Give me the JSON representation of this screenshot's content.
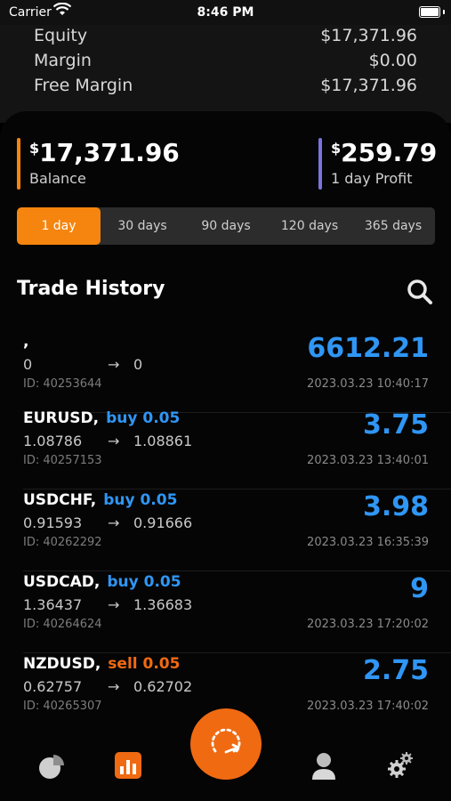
{
  "status_bar": {
    "carrier": "Carrier",
    "time": "8:46 PM"
  },
  "account": [
    {
      "label": "Equity",
      "value": "$17,371.96"
    },
    {
      "label": "Margin",
      "value": "$0.00"
    },
    {
      "label": "Free Margin",
      "value": "$17,371.96"
    }
  ],
  "balance": {
    "currency": "$",
    "amount": "17,371.96",
    "label": "Balance",
    "bar_color": "#f5850f"
  },
  "profit": {
    "currency": "$",
    "amount": "259.79",
    "label": "1 day Profit",
    "bar_color": "#7b74e0"
  },
  "periods": {
    "selected": "1 day",
    "options": [
      "1 day",
      "30 days",
      "90 days",
      "120 days",
      "365 days"
    ]
  },
  "history": {
    "title": "Trade History"
  },
  "trades": [
    {
      "symbol": ",",
      "side": "",
      "side_color": "",
      "open": "0",
      "arrow": "→",
      "close": "0",
      "id": "ID: 40253644",
      "profit": "6612.21",
      "date": "2023.03.23 10:40:17"
    },
    {
      "symbol": "EURUSD,",
      "side": "buy 0.05",
      "side_color": "#2f96f5",
      "open": "1.08786",
      "arrow": "→",
      "close": "1.08861",
      "id": "ID: 40257153",
      "profit": "3.75",
      "date": "2023.03.23 13:40:01"
    },
    {
      "symbol": "USDCHF,",
      "side": "buy 0.05",
      "side_color": "#2f96f5",
      "open": "0.91593",
      "arrow": "→",
      "close": "0.91666",
      "id": "ID: 40262292",
      "profit": "3.98",
      "date": "2023.03.23 16:35:39"
    },
    {
      "symbol": "USDCAD,",
      "side": "buy 0.05",
      "side_color": "#2f96f5",
      "open": "1.36437",
      "arrow": "→",
      "close": "1.36683",
      "id": "ID: 40264624",
      "profit": "9",
      "date": "2023.03.23 17:20:02"
    },
    {
      "symbol": "NZDUSD,",
      "side": "sell 0.05",
      "side_color": "#f06a12",
      "open": "0.62757",
      "arrow": "→",
      "close": "0.62702",
      "id": "ID: 40265307",
      "profit": "2.75",
      "date": "2023.03.23 17:40:02"
    }
  ],
  "nav": {
    "icons": [
      "pie-chart-icon",
      "bar-chart-icon",
      "refresh-icon",
      "user-icon",
      "gears-icon"
    ],
    "accent": "#f06a12"
  }
}
